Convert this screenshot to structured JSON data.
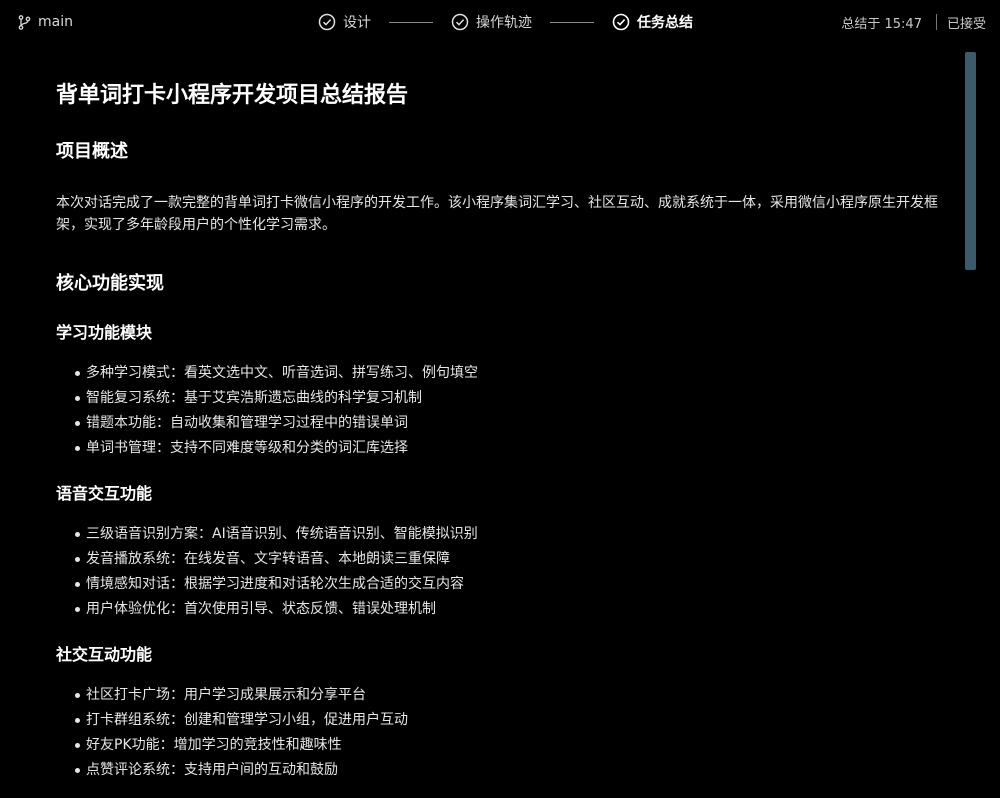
{
  "topbar": {
    "branch": "main",
    "steps": [
      {
        "label": "设计",
        "active": false
      },
      {
        "label": "操作轨迹",
        "active": false
      },
      {
        "label": "任务总结",
        "active": true
      }
    ],
    "summary_time": "总结于 15:47",
    "accepted": "已接受"
  },
  "report": {
    "title": "背单词打卡小程序开发项目总结报告",
    "overview_heading": "项目概述",
    "overview_text": "本次对话完成了一款完整的背单词打卡微信小程序的开发工作。该小程序集词汇学习、社区互动、成就系统于一体，采用微信小程序原生开发框架，实现了多年龄段用户的个性化学习需求。",
    "core_heading": "核心功能实现",
    "sections": [
      {
        "heading": "学习功能模块",
        "items": [
          "多种学习模式：看英文选中文、听音选词、拼写练习、例句填空",
          "智能复习系统：基于艾宾浩斯遗忘曲线的科学复习机制",
          "错题本功能：自动收集和管理学习过程中的错误单词",
          "单词书管理：支持不同难度等级和分类的词汇库选择"
        ]
      },
      {
        "heading": "语音交互功能",
        "items": [
          "三级语音识别方案：AI语音识别、传统语音识别、智能模拟识别",
          "发音播放系统：在线发音、文字转语音、本地朗读三重保障",
          "情境感知对话：根据学习进度和对话轮次生成合适的交互内容",
          "用户体验优化：首次使用引导、状态反馈、错误处理机制"
        ]
      },
      {
        "heading": "社交互动功能",
        "items": [
          "社区打卡广场：用户学习成果展示和分享平台",
          "打卡群组系统：创建和管理学习小组，促进用户互动",
          "好友PK功能：增加学习的竞技性和趣味性",
          "点赞评论系统：支持用户间的互动和鼓励"
        ]
      }
    ]
  }
}
